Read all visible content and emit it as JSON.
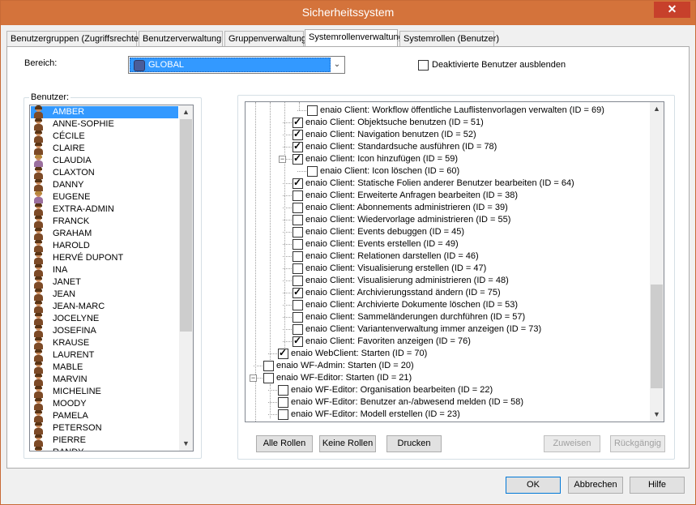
{
  "window": {
    "title": "Sicherheitssystem",
    "close_glyph": "✕"
  },
  "tabs": [
    {
      "label": "Benutzergruppen (Zugriffsrechte)",
      "active": false
    },
    {
      "label": "Benutzerverwaltung",
      "active": false
    },
    {
      "label": "Gruppenverwaltung",
      "active": false
    },
    {
      "label": "Systemrollenverwaltung",
      "active": true
    },
    {
      "label": "Systemrollen (Benutzer)",
      "active": false
    }
  ],
  "bereich": {
    "label": "Bereich:",
    "value": "GLOBAL"
  },
  "hide_inactive": {
    "label": "Deaktivierte Benutzer ausblenden",
    "checked": false
  },
  "users_group": {
    "title": "Benutzer:"
  },
  "users": [
    {
      "name": "AMBER",
      "selected": true,
      "icon": "user-icon-female"
    },
    {
      "name": "ANNE-SOPHIE",
      "icon": "user-icon"
    },
    {
      "name": "CÉCILE",
      "icon": "user-icon"
    },
    {
      "name": "CLAIRE",
      "icon": "user-icon"
    },
    {
      "name": "CLAUDIA",
      "icon": "user-icon-alt"
    },
    {
      "name": "CLAXTON",
      "icon": "user-icon"
    },
    {
      "name": "DANNY",
      "icon": "user-icon"
    },
    {
      "name": "EUGENE",
      "icon": "user-icon-alt"
    },
    {
      "name": "EXTRA-ADMIN",
      "icon": "user-icon"
    },
    {
      "name": "FRANCK",
      "icon": "user-icon"
    },
    {
      "name": "GRAHAM",
      "icon": "user-icon"
    },
    {
      "name": "HAROLD",
      "icon": "user-icon"
    },
    {
      "name": "HERVÉ DUPONT",
      "icon": "user-icon"
    },
    {
      "name": "INA",
      "icon": "user-icon"
    },
    {
      "name": "JANET",
      "icon": "user-icon"
    },
    {
      "name": "JEAN",
      "icon": "user-icon"
    },
    {
      "name": "JEAN-MARC",
      "icon": "user-icon"
    },
    {
      "name": "JOCELYNE",
      "icon": "user-icon"
    },
    {
      "name": "JOSEFINA",
      "icon": "user-icon"
    },
    {
      "name": "KRAUSE",
      "icon": "user-icon"
    },
    {
      "name": "LAURENT",
      "icon": "user-icon"
    },
    {
      "name": "MABLE",
      "icon": "user-icon"
    },
    {
      "name": "MARVIN",
      "icon": "user-icon"
    },
    {
      "name": "MICHELINE",
      "icon": "user-icon"
    },
    {
      "name": "MOODY",
      "icon": "user-icon"
    },
    {
      "name": "PAMELA",
      "icon": "user-icon"
    },
    {
      "name": "PETERSON",
      "icon": "user-icon"
    },
    {
      "name": "PIERRE",
      "icon": "user-icon"
    },
    {
      "name": "RANDY",
      "icon": "user-icon"
    }
  ],
  "roles": [
    {
      "label": "enaio Client: Workflow öffentliche Lauflistenvorlagen verwalten (ID = 69)",
      "checked": false,
      "level": 3
    },
    {
      "label": "enaio Client: Objektsuche benutzen (ID = 51)",
      "checked": true,
      "level": 2
    },
    {
      "label": "enaio Client: Navigation benutzen (ID = 52)",
      "checked": true,
      "level": 2
    },
    {
      "label": "enaio Client: Standardsuche ausführen (ID = 78)",
      "checked": true,
      "level": 2
    },
    {
      "label": "enaio Client: Icon hinzufügen (ID = 59)",
      "checked": true,
      "level": 2,
      "expander": "−"
    },
    {
      "label": "enaio Client: Icon löschen (ID = 60)",
      "checked": false,
      "level": 3
    },
    {
      "label": "enaio Client: Statische Folien anderer Benutzer bearbeiten (ID = 64)",
      "checked": true,
      "level": 2
    },
    {
      "label": "enaio Client: Erweiterte Anfragen bearbeiten (ID = 38)",
      "checked": false,
      "level": 2
    },
    {
      "label": "enaio Client: Abonnements administrieren (ID = 39)",
      "checked": false,
      "level": 2
    },
    {
      "label": "enaio Client: Wiedervorlage administrieren (ID = 55)",
      "checked": false,
      "level": 2
    },
    {
      "label": "enaio Client: Events debuggen (ID = 45)",
      "checked": false,
      "level": 2
    },
    {
      "label": "enaio Client: Events erstellen (ID = 49)",
      "checked": false,
      "level": 2
    },
    {
      "label": "enaio Client: Relationen darstellen (ID = 46)",
      "checked": false,
      "level": 2
    },
    {
      "label": "enaio Client: Visualisierung erstellen (ID = 47)",
      "checked": false,
      "level": 2
    },
    {
      "label": "enaio Client: Visualisierung administrieren (ID = 48)",
      "checked": false,
      "level": 2
    },
    {
      "label": "enaio Client: Archivierungsstand ändern (ID = 75)",
      "checked": true,
      "level": 2
    },
    {
      "label": "enaio Client: Archivierte Dokumente löschen (ID = 53)",
      "checked": false,
      "level": 2
    },
    {
      "label": "enaio Client: Sammeländerungen durchführen (ID = 57)",
      "checked": false,
      "level": 2
    },
    {
      "label": "enaio Client: Variantenverwaltung immer anzeigen (ID = 73)",
      "checked": false,
      "level": 2
    },
    {
      "label": "enaio Client: Favoriten anzeigen (ID = 76)",
      "checked": true,
      "level": 2
    },
    {
      "label": "enaio WebClient: Starten (ID = 70)",
      "checked": true,
      "level": 1
    },
    {
      "label": "enaio WF-Admin: Starten (ID = 20)",
      "checked": false,
      "level": 0
    },
    {
      "label": "enaio WF-Editor: Starten (ID = 21)",
      "checked": false,
      "level": 0,
      "expander": "−"
    },
    {
      "label": "enaio WF-Editor: Organisation bearbeiten (ID = 22)",
      "checked": false,
      "level": 1
    },
    {
      "label": "enaio WF-Editor: Benutzer an-/abwesend melden (ID = 58)",
      "checked": false,
      "level": 1
    },
    {
      "label": "enaio WF-Editor: Modell erstellen (ID = 23)",
      "checked": false,
      "level": 1
    }
  ],
  "role_buttons": {
    "all_roles": "Alle Rollen",
    "no_roles": "Keine Rollen",
    "print": "Drucken",
    "assign": "Zuweisen",
    "undo": "Rückgängig"
  },
  "dialog_buttons": {
    "ok": "OK",
    "cancel": "Abbrechen",
    "help": "Hilfe"
  },
  "scroll_glyphs": {
    "up": "▲",
    "down": "▼",
    "combo": "⌄"
  }
}
